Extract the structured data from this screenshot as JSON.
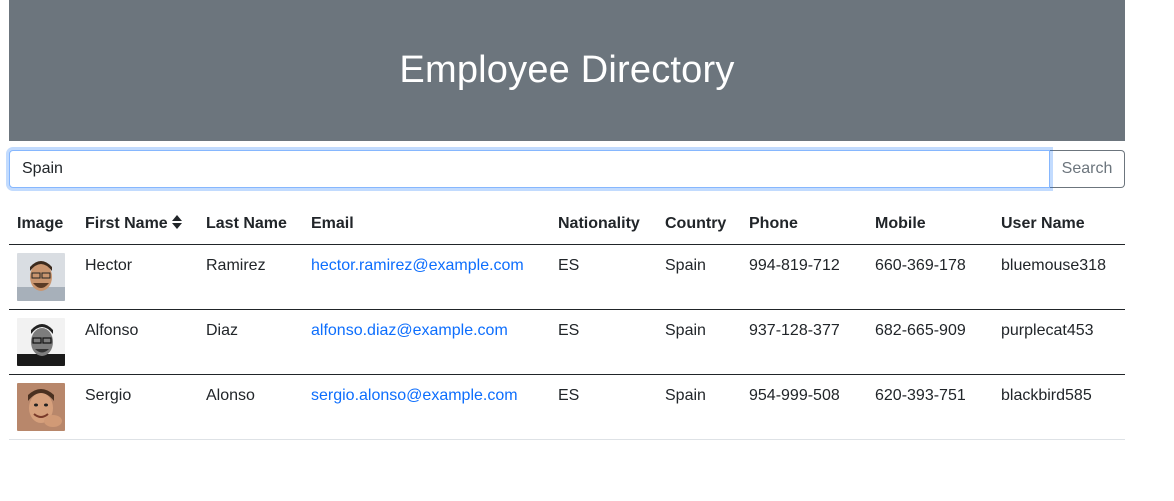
{
  "header": {
    "title": "Employee Directory"
  },
  "search": {
    "value": "Spain",
    "button_label": "Search"
  },
  "table": {
    "columns": {
      "image": "Image",
      "first_name": "First Name",
      "last_name": "Last Name",
      "email": "Email",
      "nationality": "Nationality",
      "country": "Country",
      "phone": "Phone",
      "mobile": "Mobile",
      "username": "User Name"
    },
    "sort_icon": "sort-icon",
    "rows": [
      {
        "first_name": "Hector",
        "last_name": "Ramirez",
        "email": "hector.ramirez@example.com",
        "nationality": "ES",
        "country": "Spain",
        "phone": "994-819-712",
        "mobile": "660-369-178",
        "username": "bluemouse318"
      },
      {
        "first_name": "Alfonso",
        "last_name": "Diaz",
        "email": "alfonso.diaz@example.com",
        "nationality": "ES",
        "country": "Spain",
        "phone": "937-128-377",
        "mobile": "682-665-909",
        "username": "purplecat453"
      },
      {
        "first_name": "Sergio",
        "last_name": "Alonso",
        "email": "sergio.alonso@example.com",
        "nationality": "ES",
        "country": "Spain",
        "phone": "954-999-508",
        "mobile": "620-393-751",
        "username": "blackbird585"
      }
    ]
  },
  "colors": {
    "header_bg": "#6c757d",
    "link": "#0d6efd",
    "focus_border": "#86b7fe"
  }
}
